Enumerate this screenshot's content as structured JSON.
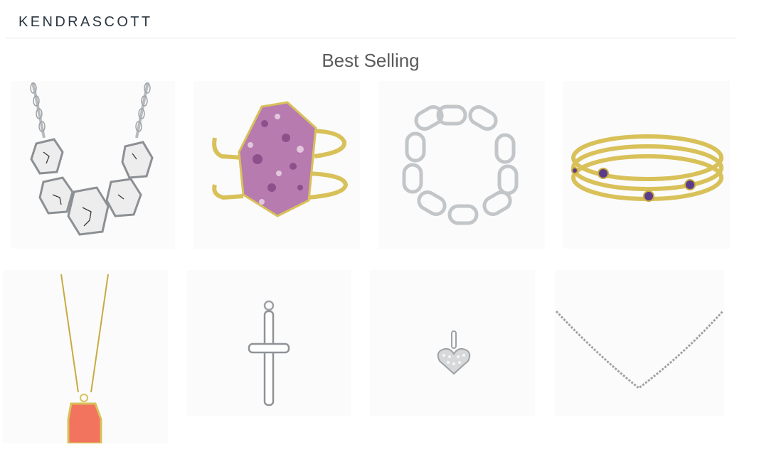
{
  "header": {
    "logo_text": "KENDRASCOTT"
  },
  "section": {
    "title": "Best Selling"
  },
  "products": [
    {
      "name": "statement-necklace",
      "icon": "white-stone-necklace-icon"
    },
    {
      "name": "drusy-cuff",
      "icon": "purple-drusy-cuff-icon"
    },
    {
      "name": "chain-bracelet",
      "icon": "silver-link-bracelet-icon"
    },
    {
      "name": "bangle-set",
      "icon": "gold-bangle-set-icon"
    },
    {
      "name": "pendant-necklace",
      "icon": "coral-pendant-icon"
    },
    {
      "name": "cross-charm",
      "icon": "silver-cross-charm-icon"
    },
    {
      "name": "heart-charm",
      "icon": "pave-heart-charm-icon"
    },
    {
      "name": "chain-necklace",
      "icon": "silver-chain-necklace-icon"
    }
  ],
  "colors": {
    "logo": "#2b3640",
    "title": "#5a5a5a",
    "divider": "#e2e2e2",
    "gold": "#d9c15a",
    "silver": "#c9cbcd",
    "coral": "#f2735e",
    "purple": "#b77bb0"
  }
}
